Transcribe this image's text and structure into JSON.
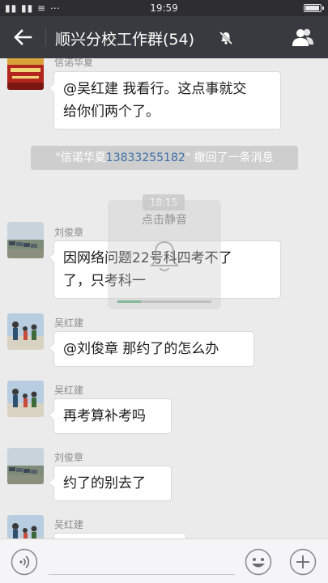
{
  "status_bar": {
    "signal_text": "诺0大 ⋯",
    "time": "19:59"
  },
  "header": {
    "title": "顺兴分校工作群(54)",
    "icons": [
      "back-arrow-icon",
      "mute-bell-icon",
      "group-members-icon"
    ]
  },
  "messages": [
    {
      "sender": "信诺华夏",
      "text_line1": "@吴红建 我看行。这点事就交",
      "text_line2": "给你们两个了。"
    },
    {
      "sender": "刘俊章",
      "text_line1": "因网络问题22号科四考不了",
      "text_line2": "了，只考科一"
    },
    {
      "sender": "吴红建",
      "text": "@刘俊章 那约了的怎么办"
    },
    {
      "sender": "吴红建",
      "text": "再考算补考吗"
    },
    {
      "sender": "刘俊章",
      "text": "约了的别去了"
    },
    {
      "sender": "吴红建"
    }
  ],
  "system_message": {
    "quote_open": "\"信诺华夏",
    "phone": "13833255182",
    "rest": "\" 撤回了一条消息"
  },
  "timestamp": "18:15",
  "mute_overlay": {
    "label": "点击静音",
    "progress": 0.25
  },
  "input_bar": {
    "value": "",
    "icons": [
      "voice-icon",
      "emoji-icon",
      "plus-icon"
    ]
  },
  "colors": {
    "title_bar": "#393a3f",
    "status_bar": "#2e2e32",
    "chat_background": "#ebebeb",
    "link_blue": "#3b6ea7"
  }
}
